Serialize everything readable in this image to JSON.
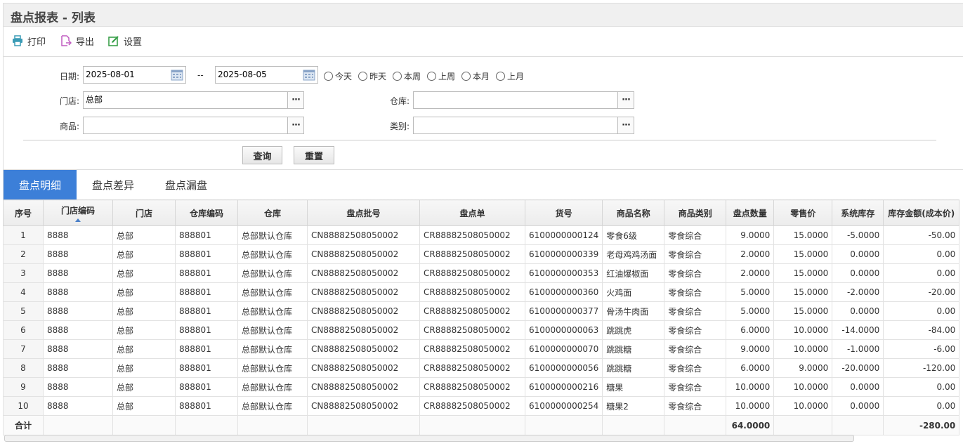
{
  "page": {
    "title": "盘点报表 - 列表"
  },
  "toolbar": {
    "print_label": "打印",
    "export_label": "导出",
    "settings_label": "设置"
  },
  "filter": {
    "date_label": "日期:",
    "date_from": "2025-08-01",
    "date_separator": "--",
    "date_to": "2025-08-05",
    "quick_dates": [
      "今天",
      "昨天",
      "本周",
      "上周",
      "本月",
      "上月"
    ],
    "store_label": "门店:",
    "store_value": "总部",
    "warehouse_label": "仓库:",
    "warehouse_value": "",
    "product_label": "商品:",
    "product_value": "",
    "category_label": "类别:",
    "category_value": "",
    "more_button": "···",
    "query_label": "查询",
    "reset_label": "重置"
  },
  "tabs": [
    {
      "label": "盘点明细",
      "active": true
    },
    {
      "label": "盘点差异",
      "active": false
    },
    {
      "label": "盘点漏盘",
      "active": false
    }
  ],
  "table": {
    "columns": [
      "序号",
      "门店编码",
      "门店",
      "仓库编码",
      "仓库",
      "盘点批号",
      "盘点单",
      "货号",
      "商品名称",
      "商品类别",
      "盘点数量",
      "零售价",
      "系统库存",
      "库存金额(成本价)"
    ],
    "rows": [
      [
        "1",
        "8888",
        "总部",
        "888801",
        "总部默认仓库",
        "CN88882508050002",
        "CR88882508050002",
        "6100000000124",
        "零食6级",
        "零食综合",
        "9.0000",
        "15.0000",
        "-5.0000",
        "-50.00"
      ],
      [
        "2",
        "8888",
        "总部",
        "888801",
        "总部默认仓库",
        "CN88882508050002",
        "CR88882508050002",
        "6100000000339",
        "老母鸡鸡汤面",
        "零食综合",
        "2.0000",
        "15.0000",
        "0.0000",
        "0.00"
      ],
      [
        "3",
        "8888",
        "总部",
        "888801",
        "总部默认仓库",
        "CN88882508050002",
        "CR88882508050002",
        "6100000000353",
        "红油爆椒面",
        "零食综合",
        "2.0000",
        "15.0000",
        "0.0000",
        "0.00"
      ],
      [
        "4",
        "8888",
        "总部",
        "888801",
        "总部默认仓库",
        "CN88882508050002",
        "CR88882508050002",
        "6100000000360",
        "火鸡面",
        "零食综合",
        "5.0000",
        "15.0000",
        "-2.0000",
        "-20.00"
      ],
      [
        "5",
        "8888",
        "总部",
        "888801",
        "总部默认仓库",
        "CN88882508050002",
        "CR88882508050002",
        "6100000000377",
        "骨汤牛肉面",
        "零食综合",
        "5.0000",
        "15.0000",
        "0.0000",
        "0.00"
      ],
      [
        "6",
        "8888",
        "总部",
        "888801",
        "总部默认仓库",
        "CN88882508050002",
        "CR88882508050002",
        "6100000000063",
        "跳跳虎",
        "零食综合",
        "6.0000",
        "10.0000",
        "-14.0000",
        "-84.00"
      ],
      [
        "7",
        "8888",
        "总部",
        "888801",
        "总部默认仓库",
        "CN88882508050002",
        "CR88882508050002",
        "6100000000070",
        "跳跳糖",
        "零食综合",
        "9.0000",
        "10.0000",
        "-1.0000",
        "-6.00"
      ],
      [
        "8",
        "8888",
        "总部",
        "888801",
        "总部默认仓库",
        "CN88882508050002",
        "CR88882508050002",
        "6100000000056",
        "跳跳糖",
        "零食综合",
        "6.0000",
        "9.0000",
        "-20.0000",
        "-120.00"
      ],
      [
        "9",
        "8888",
        "总部",
        "888801",
        "总部默认仓库",
        "CN88882508050002",
        "CR88882508050002",
        "6100000000216",
        "糖果",
        "零食综合",
        "10.0000",
        "10.0000",
        "0.0000",
        "0.00"
      ],
      [
        "10",
        "8888",
        "总部",
        "888801",
        "总部默认仓库",
        "CN88882508050002",
        "CR88882508050002",
        "6100000000254",
        "糖果2",
        "零食综合",
        "10.0000",
        "10.0000",
        "0.0000",
        "0.00"
      ]
    ],
    "total_label": "合计",
    "total_quantity": "64.0000",
    "total_amount": "-280.00"
  },
  "colors": {
    "accent": "#3c7fd8",
    "print_icon": "#3a9bb5",
    "export_icon": "#c05cc0",
    "settings_icon": "#3aa04a"
  },
  "icons": [
    "printer-icon",
    "export-icon",
    "edit-settings-icon",
    "calendar-icon",
    "ellipsis-icon",
    "sort-ascending-icon"
  ]
}
